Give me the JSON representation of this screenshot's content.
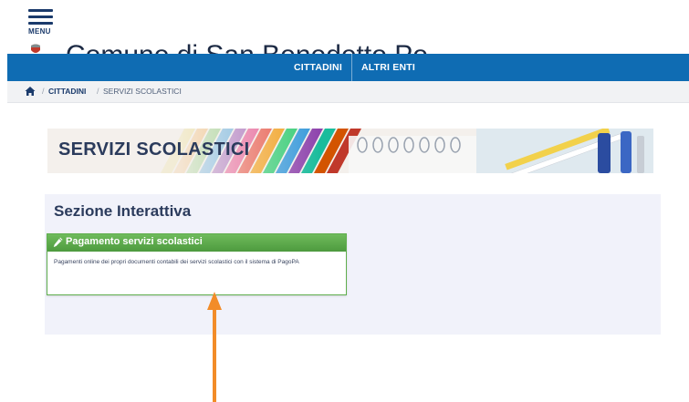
{
  "menu": {
    "label": "MENU",
    "icon": "hamburger-icon"
  },
  "site": {
    "title": "Comune di San Benedetto Po",
    "crest_icon": "municipal-crest-icon"
  },
  "navbar": {
    "bg_color": "#0f6cb3",
    "items": [
      {
        "label": "CITTADINI"
      },
      {
        "label": "ALTRI ENTI"
      }
    ]
  },
  "breadcrumb": {
    "home_icon": "home-icon",
    "separator": "/",
    "link": "CITTADINI",
    "current": "SERVIZI SCOLASTICI"
  },
  "banner": {
    "title": "SERVIZI SCOLASTICI"
  },
  "section": {
    "title": "Sezione Interattiva",
    "cards": [
      {
        "icon": "pencil-icon",
        "title": "Pagamento servizi scolastici",
        "description": "Pagamenti online dei propri documenti contabili dei servizi scolastici con il sistema di PagoPA",
        "accent_color": "#5fae4d"
      }
    ]
  },
  "annotation": {
    "type": "arrow",
    "color": "#f28c28"
  }
}
